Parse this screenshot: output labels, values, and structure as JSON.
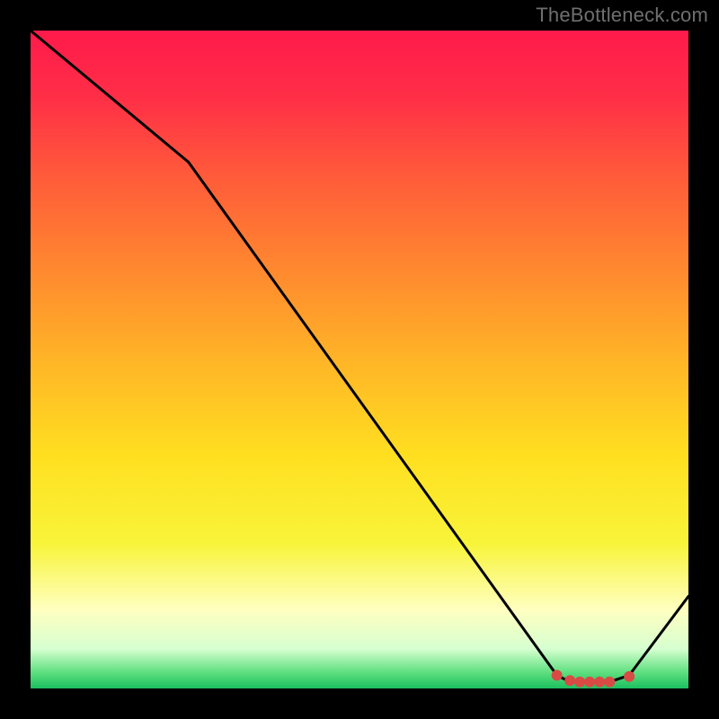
{
  "watermark": "TheBottleneck.com",
  "gradient": {
    "stops": [
      {
        "offset": 0.0,
        "color": "#ff1a4b"
      },
      {
        "offset": 0.1,
        "color": "#ff2e47"
      },
      {
        "offset": 0.22,
        "color": "#ff5a3a"
      },
      {
        "offset": 0.35,
        "color": "#ff8430"
      },
      {
        "offset": 0.5,
        "color": "#ffb427"
      },
      {
        "offset": 0.65,
        "color": "#ffe020"
      },
      {
        "offset": 0.78,
        "color": "#f8f43a"
      },
      {
        "offset": 0.88,
        "color": "#ffffc0"
      },
      {
        "offset": 0.94,
        "color": "#d6ffd0"
      },
      {
        "offset": 0.975,
        "color": "#60e080"
      },
      {
        "offset": 1.0,
        "color": "#1bbf5f"
      }
    ]
  },
  "chart_data": {
    "type": "line",
    "title": "",
    "xlabel": "",
    "ylabel": "",
    "xlim": [
      0,
      100
    ],
    "ylim": [
      0,
      100
    ],
    "x": [
      0,
      24,
      80,
      82,
      88,
      91,
      100
    ],
    "values": [
      100,
      80,
      2,
      1,
      1,
      2,
      14
    ],
    "markers_x": [
      80.0,
      82.0,
      83.5,
      85.0,
      86.5,
      88.0,
      91.0
    ],
    "markers_y": [
      2.0,
      1.2,
      1.0,
      1.0,
      1.0,
      1.0,
      1.8
    ],
    "marker_color": "#d94a45",
    "line_color": "#000000"
  }
}
